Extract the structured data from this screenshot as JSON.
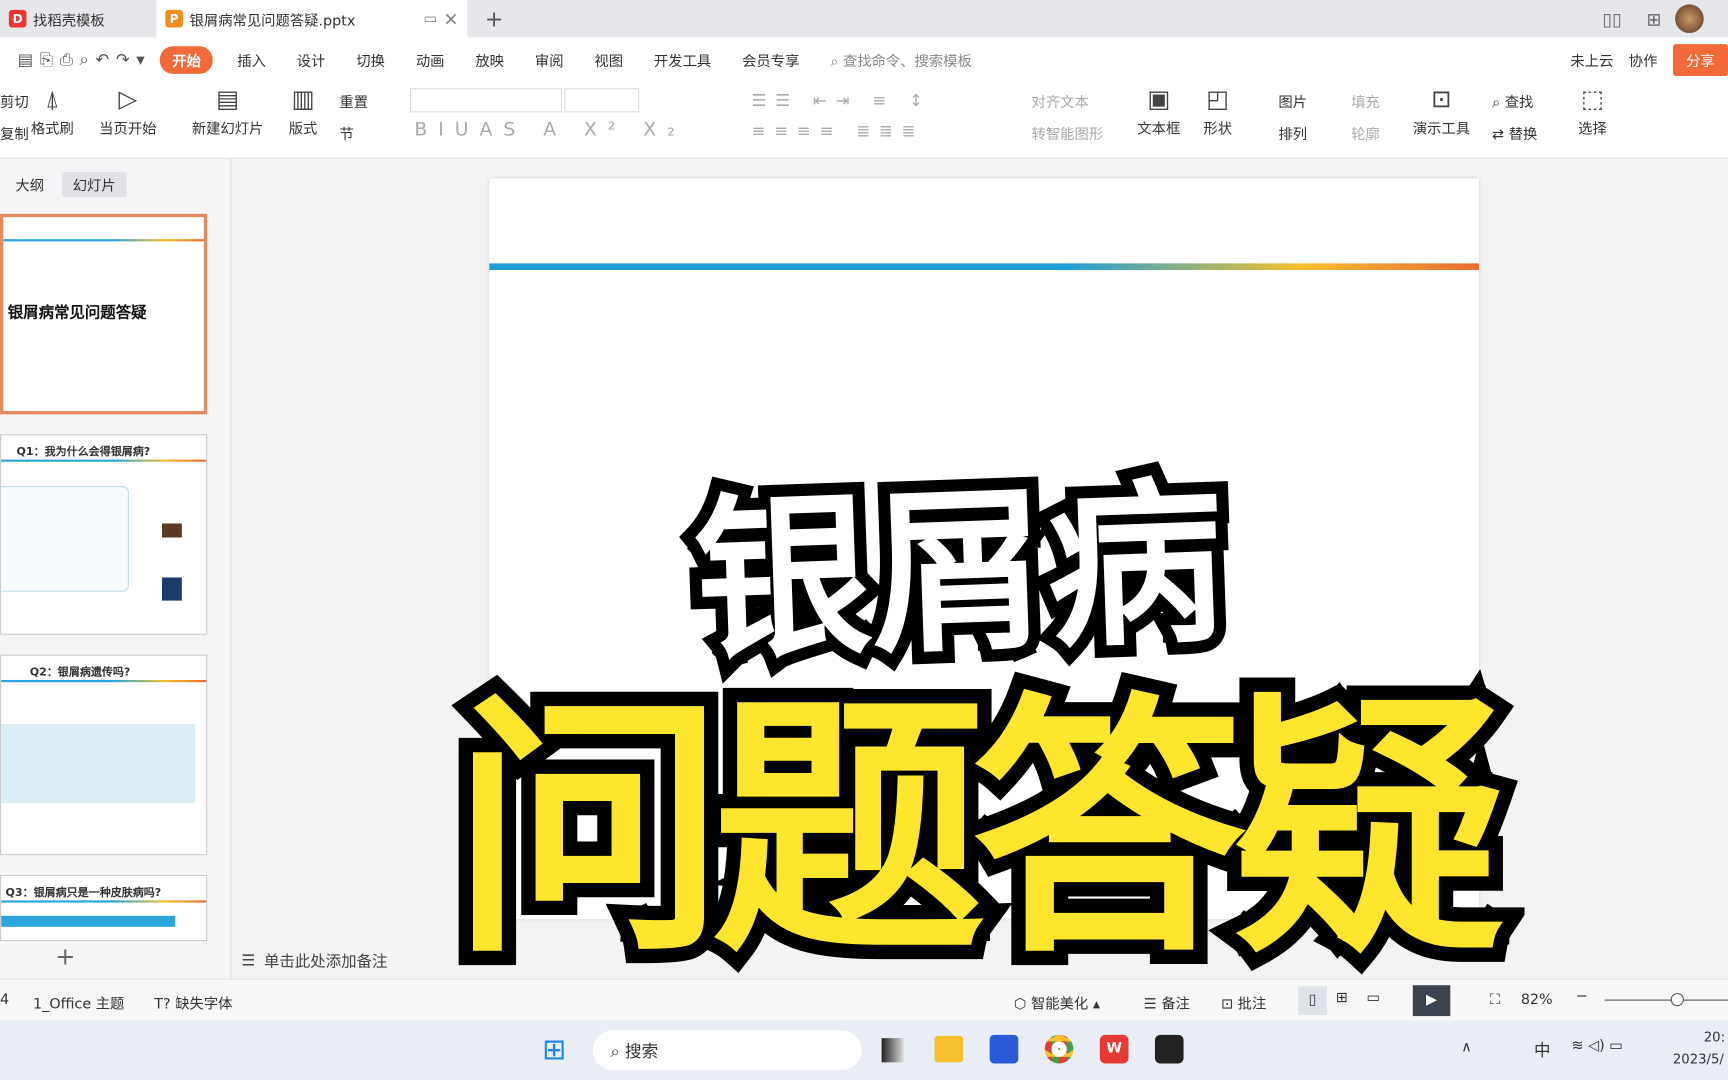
{
  "tabs": [
    {
      "label": "找稻壳模板"
    },
    {
      "label": "银屑病常见问题答疑.pptx"
    }
  ],
  "menu": [
    "开始",
    "插入",
    "设计",
    "切换",
    "动画",
    "放映",
    "审阅",
    "视图",
    "开发工具",
    "会员专享"
  ],
  "search_placeholder": "查找命令、搜索模板",
  "top_right": {
    "cloud": "未上云",
    "collab": "协作",
    "share": "分享"
  },
  "ribbon": {
    "cut": "剪切",
    "copy": "复制",
    "format_painter": "格式刷",
    "play_current": "当页开始",
    "new_slide": "新建幻灯片",
    "layout": "版式",
    "reset": "重置",
    "section": "节",
    "align_text": "对齐文本",
    "smart_shape": "转智能图形",
    "textbox": "文本框",
    "shape": "形状",
    "picture": "图片",
    "arrange": "排列",
    "fill": "填充",
    "outline": "轮廓",
    "present_tools": "演示工具",
    "find": "查找",
    "replace": "替换",
    "select": "选择"
  },
  "panel_tabs": [
    "大纲",
    "幻灯片"
  ],
  "thumbs": [
    {
      "title": "银屑病常见问题答疑"
    },
    {
      "title": "Q1：我为什么会得银屑病?"
    },
    {
      "title": "Q2：银屑病遗传吗?"
    },
    {
      "title": "Q3：银屑病只是一种皮肤病吗?"
    }
  ],
  "notes_placeholder": "单击此处添加备注",
  "overlay": {
    "line1": "银屑病",
    "line2": "问题答疑"
  },
  "status": {
    "slide_no": "4",
    "theme": "1_Office 主题",
    "missing_font": "缺失字体",
    "beautify": "智能美化",
    "notes": "备注",
    "comment": "批注",
    "zoom": "82%",
    "zoom_level": 0.6
  },
  "taskbar": {
    "search": "搜索",
    "ime": "中",
    "time": "20:",
    "date": "2023/5/"
  },
  "colors": {
    "accent": "#f26a3a",
    "overlay_yellow": "#ffe62e"
  }
}
